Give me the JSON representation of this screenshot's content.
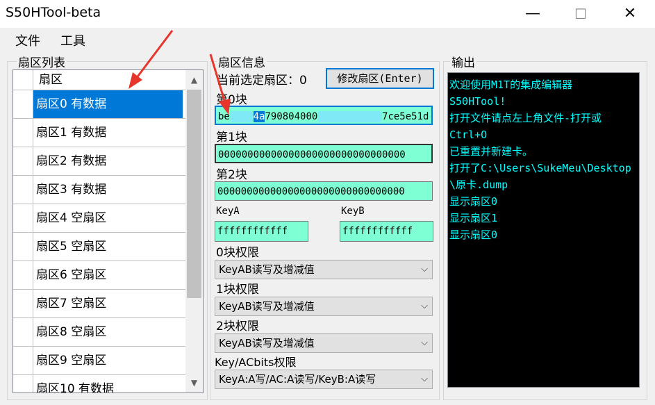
{
  "window": {
    "title": "S50HTool-beta",
    "minimize": "—",
    "maximize": "☐",
    "close": "✕"
  },
  "menu": {
    "file": "文件",
    "tools": "工具"
  },
  "sector_list": {
    "group_label": "扇区列表",
    "header": "扇区",
    "rows": [
      "扇区0 有数据",
      "扇区1 有数据",
      "扇区2 有数据",
      "扇区3 有数据",
      "扇区4 空扇区",
      "扇区5 空扇区",
      "扇区6 空扇区",
      "扇区7 空扇区",
      "扇区8 空扇区",
      "扇区9 空扇区",
      "扇区10 有数据"
    ],
    "selected_index": 0,
    "scroll_up": "▲",
    "scroll_down": "▼"
  },
  "sector_info": {
    "group_label": "扇区信息",
    "current_label": "当前选定扇区：0",
    "modify_button": "修改扇区(Enter)",
    "block0_label": "第0块",
    "block0_value_start": "be",
    "block0_value_sel": "4a",
    "block0_value_mid": "790804000",
    "block0_value_end": "7ce5e51d",
    "block1_label": "第1块",
    "block1_value": "00000000000000000000000000000000",
    "block2_label": "第2块",
    "block2_value": "00000000000000000000000000000000",
    "keyA_label": "KeyA",
    "keyA_value": "ffffffffffff",
    "keyB_label": "KeyB",
    "keyB_value": "ffffffffffff",
    "perm0_label": "0块权限",
    "perm0_value": "KeyAB读写及增减值",
    "perm1_label": "1块权限",
    "perm1_value": "KeyAB读写及增减值",
    "perm2_label": "2块权限",
    "perm2_value": "KeyAB读写及增减值",
    "permkey_label": "Key/ACbits权限",
    "permkey_value": "KeyA:A写/AC:A读写/KeyB:A读写",
    "dropdown_glyph": "⌵"
  },
  "output": {
    "group_label": "输出",
    "lines": [
      "欢迎使用M1T的集成编辑器",
      "S50HTool!",
      "打开文件请点左上角文件-打开或",
      "Ctrl+O",
      "已重置并新建卡。",
      "打开了C:\\Users\\SukeMeu\\Desktop",
      "\\原卡.dump",
      "显示扇区0",
      "显示扇区1",
      "显示扇区0"
    ]
  },
  "colors": {
    "accent": "#0078d7",
    "field": "#7fffd4",
    "output_text": "#00ffff",
    "annotation": "#e8352b"
  }
}
